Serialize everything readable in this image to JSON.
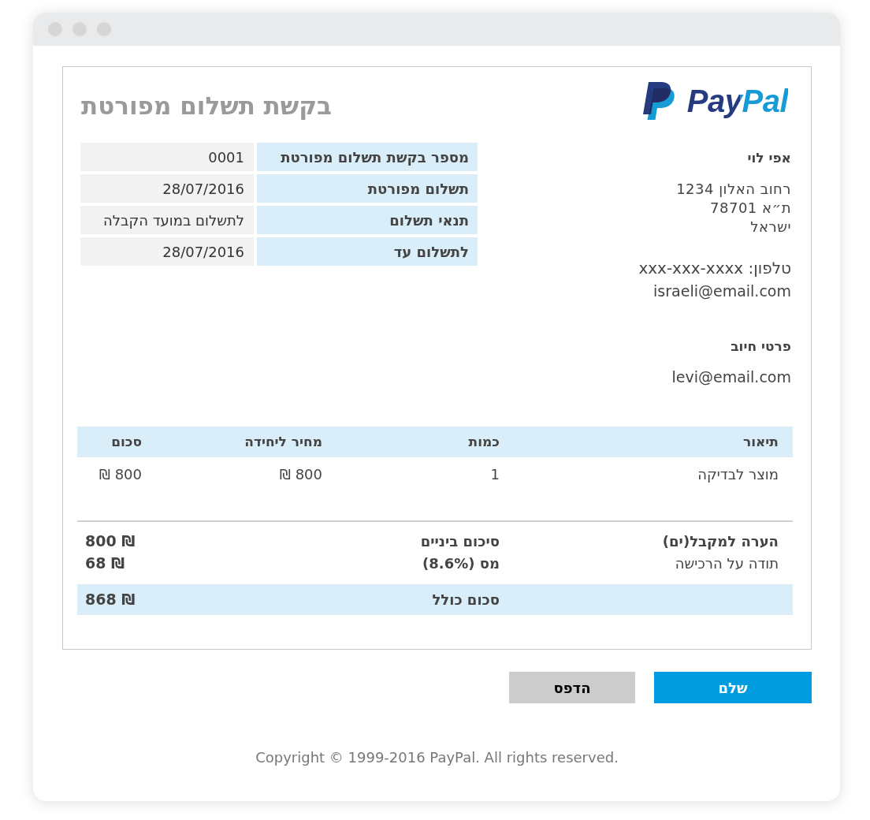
{
  "header": {
    "logo": {
      "wordmark": "PayPal"
    },
    "title": "בקשת תשלום מפורטת"
  },
  "details": [
    {
      "label": "מספר בקשת תשלום מפורטת",
      "value": "0001"
    },
    {
      "label": "תשלום מפורטת",
      "value": "28/07/2016"
    },
    {
      "label": "תנאי תשלום",
      "value": "לתשלום במועד הקבלה"
    },
    {
      "label": "לתשלום עד",
      "value": "28/07/2016"
    }
  ],
  "sender": {
    "name": "אפי לוי",
    "address": [
      "רחוב האלון 1234",
      "ת״א 78701",
      "ישראל"
    ],
    "phone": "טלפון: xxx-xxx-xxxx",
    "email": "israeli@email.com"
  },
  "billing": {
    "heading": "פרטי חיוב",
    "email": "levi@email.com"
  },
  "items_table": {
    "columns": [
      "תיאור",
      "כמות",
      "מחיר ליחידה",
      "סכום"
    ],
    "rows": [
      [
        "מוצר לבדיקה",
        "1",
        "₪ 800",
        "₪ 800"
      ]
    ]
  },
  "note": {
    "heading": "הערה למקבל(ים)",
    "text": "תודה על הרכישה"
  },
  "totals": [
    {
      "label": "סיכום ביניים",
      "value": "800 ₪"
    },
    {
      "label": "מס (8.6%)",
      "value": "68 ₪"
    }
  ],
  "grand_total": {
    "label": "סכום כולל",
    "value": "868 ₪"
  },
  "buttons": [
    {
      "label": "שלם",
      "kind": "primary"
    },
    {
      "label": "הדפס",
      "kind": "secondary"
    }
  ],
  "footer": "Copyright © 1999-2016 PayPal. All rights reserved."
}
